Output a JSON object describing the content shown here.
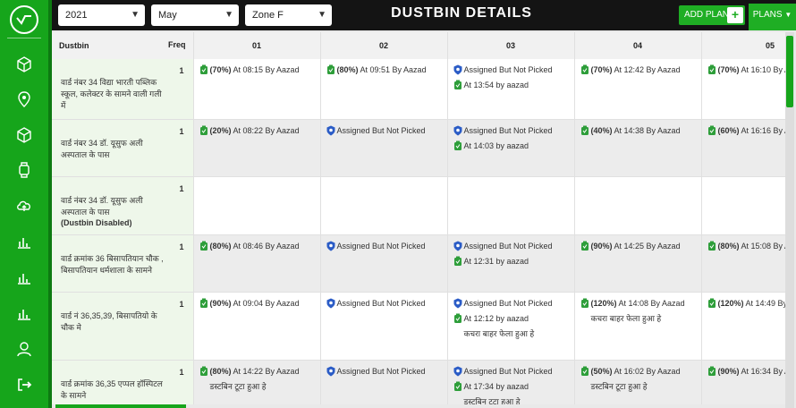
{
  "header": {
    "year": "2021",
    "month": "May",
    "zone": "Zone F",
    "title": "DUSTBIN DETAILS",
    "add_plan": "ADD PLAN",
    "add_plan_icon": "+",
    "plans": "PLANS"
  },
  "sidebar": {
    "icons": [
      "logo-icon",
      "cube-icon",
      "location-pin-icon",
      "cube-outline-icon",
      "watch-icon",
      "cloud-upload-icon",
      "bar-chart-icon",
      "bar-chart-icon",
      "bar-chart-icon",
      "user-icon",
      "logout-icon"
    ]
  },
  "table": {
    "col_dustbin": "Dustbin",
    "col_freq": "Freq",
    "days": [
      "01",
      "02",
      "03",
      "04",
      "05"
    ],
    "rows": [
      {
        "name": "वार्ड नंबर 34 विद्या भारती पब्लिक स्कूल, कलेक्टर के सामने वाली गली में",
        "disabled": "",
        "freq": "1",
        "cells": [
          [
            {
              "type": "green",
              "pct": "(70%)",
              "text": " At 08:15 By Aazad",
              "note": ""
            }
          ],
          [
            {
              "type": "green",
              "pct": "(80%)",
              "text": " At 09:51 By Aazad",
              "note": ""
            }
          ],
          [
            {
              "type": "blue",
              "pct": "",
              "text": "Assigned But Not Picked",
              "note": ""
            },
            {
              "type": "green",
              "pct": "",
              "text": "At 13:54 by aazad",
              "note": ""
            }
          ],
          [
            {
              "type": "green",
              "pct": "(70%)",
              "text": " At 12:42 By Aazad",
              "note": ""
            }
          ],
          [
            {
              "type": "green",
              "pct": "(70%)",
              "text": " At 16:10 By Aazad",
              "note": ""
            }
          ]
        ]
      },
      {
        "name": "वार्ड नंबर 34 डॉ. यूसुफ अली अस्पताल के पास",
        "disabled": "",
        "freq": "1",
        "cells": [
          [
            {
              "type": "green",
              "pct": "(20%)",
              "text": " At 08:22 By Aazad",
              "note": ""
            }
          ],
          [
            {
              "type": "blue",
              "pct": "",
              "text": "Assigned But Not Picked",
              "note": ""
            }
          ],
          [
            {
              "type": "blue",
              "pct": "",
              "text": "Assigned But Not Picked",
              "note": ""
            },
            {
              "type": "green",
              "pct": "",
              "text": "At 14:03 by aazad",
              "note": ""
            }
          ],
          [
            {
              "type": "green",
              "pct": "(40%)",
              "text": " At 14:38 By Aazad",
              "note": ""
            }
          ],
          [
            {
              "type": "green",
              "pct": "(60%)",
              "text": " At 16:16 By Aazad",
              "note": ""
            }
          ]
        ]
      },
      {
        "name": "वार्ड नंबर 34 डॉ. यूसुफ अली अस्पताल के पास",
        "disabled": "(Dustbin Disabled)",
        "freq": "1",
        "cells": [
          [],
          [],
          [],
          [],
          []
        ]
      },
      {
        "name": "वार्ड क्रमांक 36 बिसापतियान चौक , बिसापतियान धर्मशाला के सामने",
        "disabled": "",
        "freq": "1",
        "cells": [
          [
            {
              "type": "green",
              "pct": "(80%)",
              "text": " At 08:46 By Aazad",
              "note": ""
            }
          ],
          [
            {
              "type": "blue",
              "pct": "",
              "text": "Assigned But Not Picked",
              "note": ""
            }
          ],
          [
            {
              "type": "blue",
              "pct": "",
              "text": "Assigned But Not Picked",
              "note": ""
            },
            {
              "type": "green",
              "pct": "",
              "text": "At 12:31 by aazad",
              "note": ""
            }
          ],
          [
            {
              "type": "green",
              "pct": "(90%)",
              "text": " At 14:25 By Aazad",
              "note": ""
            }
          ],
          [
            {
              "type": "green",
              "pct": "(80%)",
              "text": " At 15:08 By Aazad",
              "note": ""
            }
          ]
        ]
      },
      {
        "name": "वार्ड नं 36,35,39, बिसापतियो के चौक मे",
        "disabled": "",
        "freq": "1",
        "cells": [
          [
            {
              "type": "green",
              "pct": "(90%)",
              "text": " At 09:04 By Aazad",
              "note": ""
            }
          ],
          [
            {
              "type": "blue",
              "pct": "",
              "text": "Assigned But Not Picked",
              "note": ""
            }
          ],
          [
            {
              "type": "blue",
              "pct": "",
              "text": "Assigned But Not Picked",
              "note": ""
            },
            {
              "type": "green",
              "pct": "",
              "text": "At 12:12 by aazad",
              "note": "कचरा बाहर फेला हुआ हे"
            }
          ],
          [
            {
              "type": "green",
              "pct": "(120%)",
              "text": " At 14:08 By Aazad",
              "note": "कचरा बाहर फेला हुआ हे"
            }
          ],
          [
            {
              "type": "green",
              "pct": "(120%)",
              "text": " At 14:49 By Aazad",
              "note": ""
            }
          ]
        ]
      },
      {
        "name": "वार्ड क्रमांक 36,35 एप्पल हॉस्पिटल के सामने",
        "disabled": "",
        "freq": "1",
        "cells": [
          [
            {
              "type": "green",
              "pct": "(80%)",
              "text": " At 14:22 By Aazad",
              "note": "डस्टबिन टूटा हुआ हे"
            }
          ],
          [
            {
              "type": "blue",
              "pct": "",
              "text": "Assigned But Not Picked",
              "note": ""
            }
          ],
          [
            {
              "type": "blue",
              "pct": "",
              "text": "Assigned But Not Picked",
              "note": ""
            },
            {
              "type": "green",
              "pct": "",
              "text": "At 17:34 by aazad",
              "note": "डस्टबिन टूटा हुआ हे"
            }
          ],
          [
            {
              "type": "green",
              "pct": "(50%)",
              "text": " At 16:02 By Aazad",
              "note": "डस्टबिन टूटा हुआ हे"
            }
          ],
          [
            {
              "type": "green",
              "pct": "(90%)",
              "text": " At 16:34 By Aazad",
              "note": ""
            }
          ]
        ]
      }
    ]
  },
  "colors": {
    "accent": "#16a51b",
    "header_bg": "#141414",
    "bin_bg": "#eef7ea",
    "blue_icon": "#2b5cc6"
  }
}
